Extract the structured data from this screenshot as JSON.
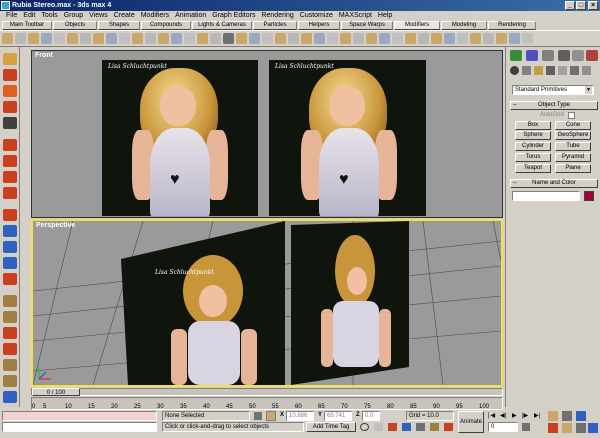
{
  "window": {
    "title": "Rubia Stereo.max - 3ds max 4"
  },
  "menu": [
    "File",
    "Edit",
    "Tools",
    "Group",
    "Views",
    "Create",
    "Modifiers",
    "Animation",
    "Graph Editors",
    "Rendering",
    "Customize",
    "MAXScript",
    "Help"
  ],
  "tabs": [
    "Main Toolbar",
    "Objects",
    "Shapes",
    "Compounds",
    "Lights & Cameras",
    "Particles",
    "Helpers",
    "Space Warps",
    "Modifiers",
    "Modeling",
    "Rendering"
  ],
  "active_tab": "Modifiers",
  "viewports": {
    "front": {
      "label": "Front"
    },
    "perspective": {
      "label": "Perspective"
    }
  },
  "image_signature": "Lisa Schluchtpunkt",
  "command_panel": {
    "category_dropdown": "Standard Primitives",
    "object_type_header": "Object Type",
    "autogrid_label": "AutoGrid",
    "buttons": [
      "Box",
      "Cone",
      "Sphere",
      "GeoSphere",
      "Cylinder",
      "Tube",
      "Torus",
      "Pyramid",
      "Teapot",
      "Plane"
    ],
    "name_color_header": "Name and Color",
    "name_value": "",
    "color_swatch": "#a0003a"
  },
  "timeline": {
    "frame_display": "0 / 100",
    "ticks": [
      "0",
      "5",
      "10",
      "15",
      "20",
      "25",
      "30",
      "35",
      "40",
      "45",
      "50",
      "55",
      "60",
      "65",
      "70",
      "75",
      "80",
      "85",
      "90",
      "95",
      "100"
    ]
  },
  "status": {
    "selection": "None Selected",
    "prompt": "Click or click-and-drag to select objects",
    "x_label": "X",
    "x_value": "10.886",
    "y_label": "Y",
    "y_value": "65.741",
    "z_label": "Z",
    "z_value": "0.0",
    "grid": "Grid = 10.0",
    "add_time_tag": "Add Time Tag",
    "animate": "Animate",
    "frame": "0"
  },
  "colors": {
    "titlebar": "#0a246a",
    "viewport_bg": "#9a9a9a",
    "active_viewport_border": "#f2e24a"
  }
}
